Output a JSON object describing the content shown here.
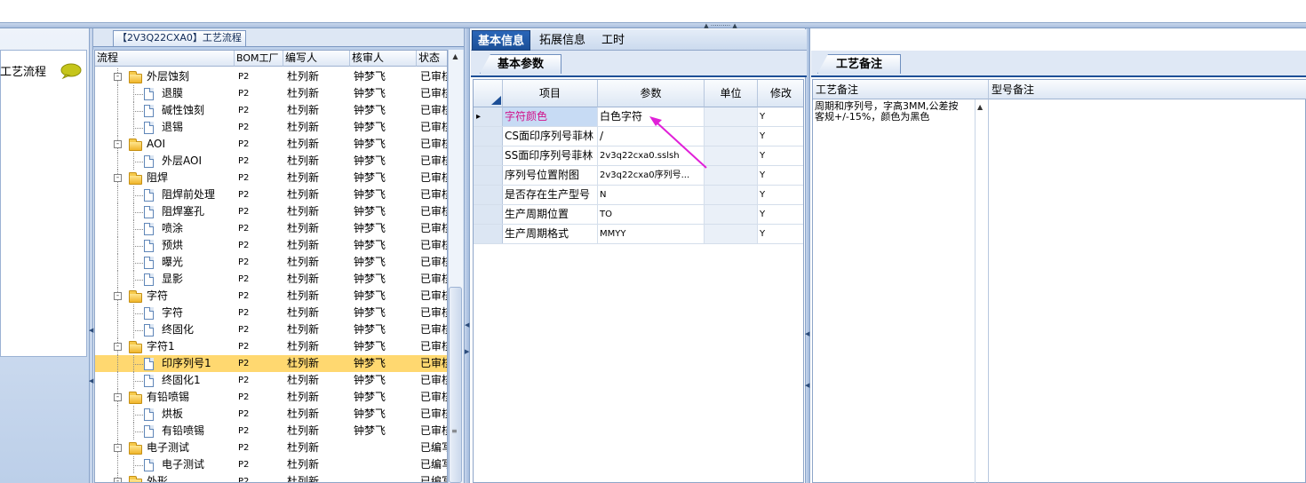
{
  "left_panel": {
    "title": "【2V3Q22CXA0】工艺流程",
    "sidebar_label": "工艺流程",
    "columns": [
      "流程",
      "BOM工厂",
      "编写人",
      "核审人",
      "状态"
    ],
    "rows": [
      {
        "name": "外层蚀刻",
        "level": 0,
        "type": "folder",
        "bom": "P2",
        "writer": "杜列新",
        "reviewer": "钟梦飞",
        "status": "已审核"
      },
      {
        "name": "退膜",
        "level": 1,
        "type": "doc",
        "bom": "P2",
        "writer": "杜列新",
        "reviewer": "钟梦飞",
        "status": "已审核"
      },
      {
        "name": "碱性蚀刻",
        "level": 1,
        "type": "doc",
        "bom": "P2",
        "writer": "杜列新",
        "reviewer": "钟梦飞",
        "status": "已审核"
      },
      {
        "name": "退锡",
        "level": 1,
        "type": "doc",
        "bom": "P2",
        "writer": "杜列新",
        "reviewer": "钟梦飞",
        "status": "已审核"
      },
      {
        "name": "AOI",
        "level": 0,
        "type": "folder",
        "bom": "P2",
        "writer": "杜列新",
        "reviewer": "钟梦飞",
        "status": "已审核"
      },
      {
        "name": "外层AOI",
        "level": 1,
        "type": "doc",
        "bom": "P2",
        "writer": "杜列新",
        "reviewer": "钟梦飞",
        "status": "已审核"
      },
      {
        "name": "阻焊",
        "level": 0,
        "type": "folder",
        "bom": "P2",
        "writer": "杜列新",
        "reviewer": "钟梦飞",
        "status": "已审核"
      },
      {
        "name": "阻焊前处理",
        "level": 1,
        "type": "doc",
        "bom": "P2",
        "writer": "杜列新",
        "reviewer": "钟梦飞",
        "status": "已审核"
      },
      {
        "name": "阻焊塞孔",
        "level": 1,
        "type": "doc",
        "bom": "P2",
        "writer": "杜列新",
        "reviewer": "钟梦飞",
        "status": "已审核"
      },
      {
        "name": "喷涂",
        "level": 1,
        "type": "doc",
        "bom": "P2",
        "writer": "杜列新",
        "reviewer": "钟梦飞",
        "status": "已审核"
      },
      {
        "name": "预烘",
        "level": 1,
        "type": "doc",
        "bom": "P2",
        "writer": "杜列新",
        "reviewer": "钟梦飞",
        "status": "已审核"
      },
      {
        "name": "曝光",
        "level": 1,
        "type": "doc",
        "bom": "P2",
        "writer": "杜列新",
        "reviewer": "钟梦飞",
        "status": "已审核"
      },
      {
        "name": "显影",
        "level": 1,
        "type": "doc",
        "bom": "P2",
        "writer": "杜列新",
        "reviewer": "钟梦飞",
        "status": "已审核"
      },
      {
        "name": "字符",
        "level": 0,
        "type": "folder",
        "bom": "P2",
        "writer": "杜列新",
        "reviewer": "钟梦飞",
        "status": "已审核"
      },
      {
        "name": "字符",
        "level": 1,
        "type": "doc",
        "bom": "P2",
        "writer": "杜列新",
        "reviewer": "钟梦飞",
        "status": "已审核"
      },
      {
        "name": "终固化",
        "level": 1,
        "type": "doc",
        "bom": "P2",
        "writer": "杜列新",
        "reviewer": "钟梦飞",
        "status": "已审核"
      },
      {
        "name": "字符1",
        "level": 0,
        "type": "folder",
        "bom": "P2",
        "writer": "杜列新",
        "reviewer": "钟梦飞",
        "status": "已审核"
      },
      {
        "name": "印序列号1",
        "level": 1,
        "type": "doc",
        "bom": "P2",
        "writer": "杜列新",
        "reviewer": "钟梦飞",
        "status": "已审核",
        "selected": true
      },
      {
        "name": "终固化1",
        "level": 1,
        "type": "doc",
        "bom": "P2",
        "writer": "杜列新",
        "reviewer": "钟梦飞",
        "status": "已审核"
      },
      {
        "name": "有铅喷锡",
        "level": 0,
        "type": "folder",
        "bom": "P2",
        "writer": "杜列新",
        "reviewer": "钟梦飞",
        "status": "已审核"
      },
      {
        "name": "烘板",
        "level": 1,
        "type": "doc",
        "bom": "P2",
        "writer": "杜列新",
        "reviewer": "钟梦飞",
        "status": "已审核"
      },
      {
        "name": "有铅喷锡",
        "level": 1,
        "type": "doc",
        "bom": "P2",
        "writer": "杜列新",
        "reviewer": "钟梦飞",
        "status": "已审核"
      },
      {
        "name": "电子测试",
        "level": 0,
        "type": "folder",
        "bom": "P2",
        "writer": "杜列新",
        "reviewer": "",
        "status": "已编写"
      },
      {
        "name": "电子测试",
        "level": 1,
        "type": "doc",
        "bom": "P2",
        "writer": "杜列新",
        "reviewer": "",
        "status": "已编写"
      },
      {
        "name": "外形",
        "level": 0,
        "type": "folder",
        "bom": "P2",
        "writer": "杜列新",
        "reviewer": "",
        "status": "已编写"
      }
    ]
  },
  "middle_panel": {
    "tabs": [
      "基本信息",
      "拓展信息",
      "工时"
    ],
    "active_tab": 0,
    "sub_tab": "基本参数",
    "columns": [
      "项目",
      "参数",
      "单位",
      "修改"
    ],
    "rows": [
      {
        "item": "字符颜色",
        "param": "白色字符",
        "unit": "",
        "modify": "Y",
        "current": true
      },
      {
        "item": "CS面印序列号菲林",
        "param": "/",
        "unit": "",
        "modify": "Y"
      },
      {
        "item": "SS面印序列号菲林",
        "param": "2v3q22cxa0.sslsh",
        "unit": "",
        "modify": "Y"
      },
      {
        "item": "序列号位置附图",
        "param": "2v3q22cxa0序列号...",
        "unit": "",
        "modify": "Y"
      },
      {
        "item": "是否存在生产型号",
        "param": "N",
        "unit": "",
        "modify": "Y"
      },
      {
        "item": "生产周期位置",
        "param": "TO",
        "unit": "",
        "modify": "Y"
      },
      {
        "item": "生产周期格式",
        "param": "MMYY",
        "unit": "",
        "modify": "Y"
      }
    ],
    "annotation_color": "#e020d8",
    "highlight_text_color": "#d1128a"
  },
  "right_panel": {
    "sub_tab": "工艺备注",
    "columns": [
      "工艺备注",
      "型号备注"
    ],
    "remark": "周期和序列号，字高3MM,公差按\n客规+/-15%，颜色为黑色"
  }
}
